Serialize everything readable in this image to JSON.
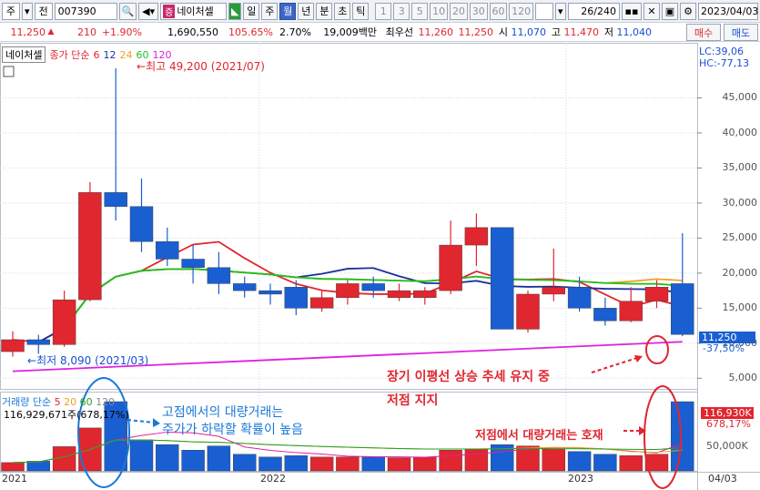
{
  "toolbar": {
    "type_label": "주",
    "prefix_label": "전",
    "code_value": "007390",
    "stock_tag": "증",
    "stock_name": "네이처셀",
    "periods": [
      "일",
      "주",
      "월",
      "년",
      "분",
      "초",
      "틱"
    ],
    "selected_period": "월",
    "intervals": [
      "1",
      "3",
      "5",
      "10",
      "20",
      "30",
      "60",
      "120"
    ],
    "count_value": "26",
    "count_total": "/240",
    "date_value": "2023/04/03"
  },
  "quote": {
    "price": "11,250",
    "change": "210",
    "change_pct": "+1.90%",
    "volume": "1,690,550",
    "volume_ratio": "105.65%",
    "turnover_pct": "2.70%",
    "amount": "19,009백만",
    "best_label": "최우선",
    "best_ask": "11,260",
    "best_bid": "11,250",
    "open_label": "시",
    "open": "11,070",
    "high_label": "고",
    "high": "11,470",
    "low_label": "저",
    "low": "11,040",
    "buy_label": "매수",
    "sell_label": "매도"
  },
  "legend": {
    "name": "네이처셀",
    "ma_title": "종가 단순",
    "ma_periods": [
      "6",
      "12",
      "24",
      "60",
      "120"
    ],
    "ma_colors": [
      "#e0262f",
      "#1b2f9c",
      "#f0a020",
      "#20c020",
      "#e020e0"
    ]
  },
  "price_axis": {
    "labels": [
      "45,000",
      "40,000",
      "35,000",
      "30,000",
      "25,000",
      "20,000",
      "15,000",
      "10,000",
      "5,000"
    ],
    "lc": "LC:39,06",
    "hc": "HC:-77,13",
    "current": "11,250",
    "current_pct": "-37,50%"
  },
  "volume_panel": {
    "title": "거래량",
    "ma_title": "단순",
    "ma_periods": [
      "5",
      "20",
      "60",
      "120"
    ],
    "value": "116,929,671주(678,17%)",
    "axis_current": "116,930K",
    "axis_pct": "678,17%",
    "axis_label": "50,000K"
  },
  "time_axis": {
    "labels": [
      "2021",
      "2022",
      "2023"
    ],
    "end_label": "04/03"
  },
  "annotations": {
    "high_label": "최고 49,200 (2021/07)",
    "low_label": "최저 8,090 (2021/03)",
    "trend_line1": "장기 이평선 상승 추세 유지 중",
    "trend_line2": "저점 지지",
    "volume_note": "저점에서 대량거래는 호재",
    "top_volume_line1": "고점에서의 대량거래는",
    "top_volume_line2": "주가가 하락할 확률이 높음"
  },
  "chart_data": {
    "type": "candlestick",
    "period": "monthly",
    "up_color": "#e0262f",
    "down_color": "#1a5fd1",
    "ylim": [
      4000,
      50000
    ],
    "candles": [
      {
        "o": 8800,
        "h": 11700,
        "l": 8090,
        "c": 10500
      },
      {
        "o": 10500,
        "h": 11200,
        "l": 8500,
        "c": 9800
      },
      {
        "o": 9800,
        "h": 17500,
        "l": 9500,
        "c": 16200
      },
      {
        "o": 16200,
        "h": 33000,
        "l": 16000,
        "c": 31500
      },
      {
        "o": 31500,
        "h": 49200,
        "l": 27500,
        "c": 29500
      },
      {
        "o": 29500,
        "h": 33500,
        "l": 23000,
        "c": 24500
      },
      {
        "o": 24500,
        "h": 26500,
        "l": 21000,
        "c": 22000
      },
      {
        "o": 22000,
        "h": 24000,
        "l": 18500,
        "c": 20800
      },
      {
        "o": 20800,
        "h": 23000,
        "l": 17000,
        "c": 18500
      },
      {
        "o": 18500,
        "h": 19500,
        "l": 16500,
        "c": 17500
      },
      {
        "o": 17500,
        "h": 18500,
        "l": 15500,
        "c": 17000
      },
      {
        "o": 18000,
        "h": 19000,
        "l": 14000,
        "c": 15000
      },
      {
        "o": 15000,
        "h": 17500,
        "l": 14500,
        "c": 16500
      },
      {
        "o": 16500,
        "h": 19000,
        "l": 15500,
        "c": 18500
      },
      {
        "o": 18500,
        "h": 19500,
        "l": 16500,
        "c": 17500
      },
      {
        "o": 16500,
        "h": 18500,
        "l": 16000,
        "c": 17500
      },
      {
        "o": 16500,
        "h": 18000,
        "l": 15500,
        "c": 17500
      },
      {
        "o": 17500,
        "h": 27500,
        "l": 17000,
        "c": 24000
      },
      {
        "o": 24000,
        "h": 28500,
        "l": 21000,
        "c": 26500
      },
      {
        "o": 26500,
        "h": 26500,
        "l": 12000,
        "c": 12000
      },
      {
        "o": 12000,
        "h": 17500,
        "l": 11500,
        "c": 17000
      },
      {
        "o": 17000,
        "h": 23500,
        "l": 16000,
        "c": 18000
      },
      {
        "o": 18000,
        "h": 19500,
        "l": 14500,
        "c": 15000
      },
      {
        "o": 15000,
        "h": 16500,
        "l": 12500,
        "c": 13200
      },
      {
        "o": 13200,
        "h": 18000,
        "l": 13000,
        "c": 16000
      },
      {
        "o": 16000,
        "h": 19000,
        "l": 15000,
        "c": 18000
      },
      {
        "o": 18500,
        "h": 25700,
        "l": 11000,
        "c": 11250
      }
    ],
    "volumes": [
      12,
      14,
      35,
      62,
      100,
      45,
      38,
      30,
      36,
      24,
      20,
      22,
      20,
      20,
      20,
      19,
      20,
      30,
      32,
      38,
      36,
      32,
      28,
      24,
      22,
      24,
      100
    ]
  }
}
